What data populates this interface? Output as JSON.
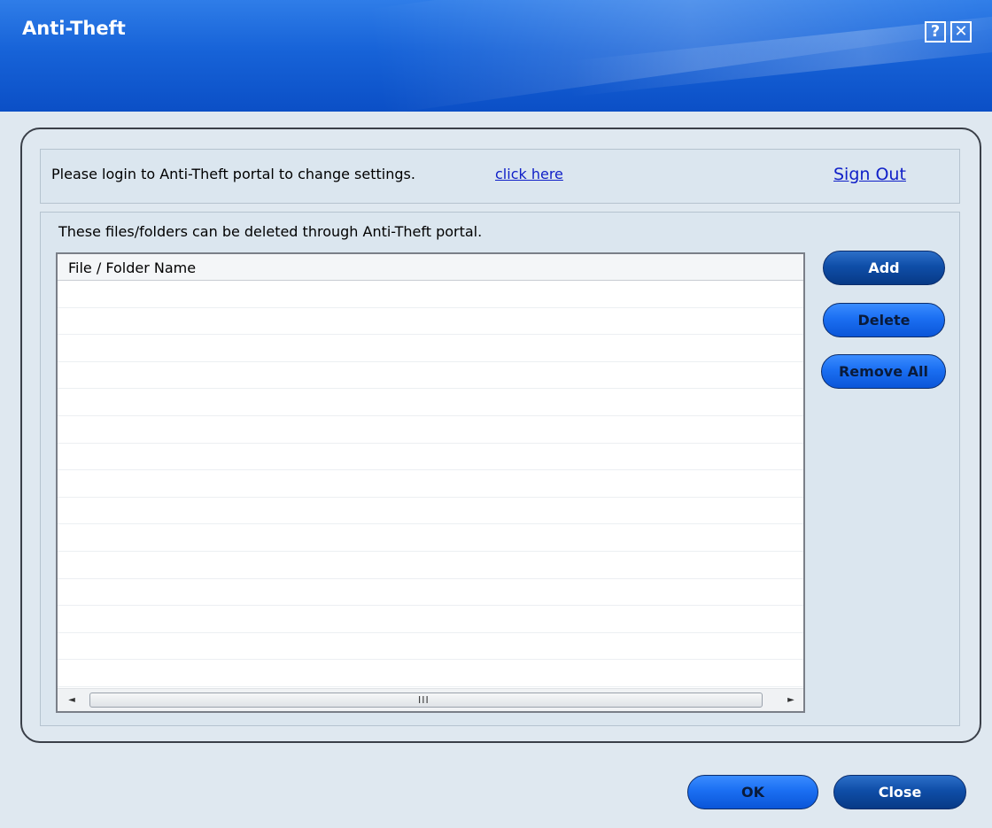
{
  "window": {
    "title": "Anti-Theft",
    "help_glyph": "?",
    "close_glyph": "✕"
  },
  "login": {
    "message": "Please login to Anti-Theft portal to change settings.",
    "link_text": "click here",
    "sign_out": "Sign Out"
  },
  "files": {
    "description": "These files/folders can be deleted through Anti-Theft portal.",
    "column_header": "File / Folder Name",
    "rows": [],
    "scroll_grip": "III"
  },
  "actions": {
    "add": "Add",
    "delete": "Delete",
    "remove_all": "Remove All"
  },
  "footer": {
    "ok": "OK",
    "close": "Close"
  },
  "colors": {
    "title_bar": "#1763d8",
    "link": "#1020c8",
    "button_dark": "#0f4ea8",
    "button_bright": "#1b6ff2"
  }
}
